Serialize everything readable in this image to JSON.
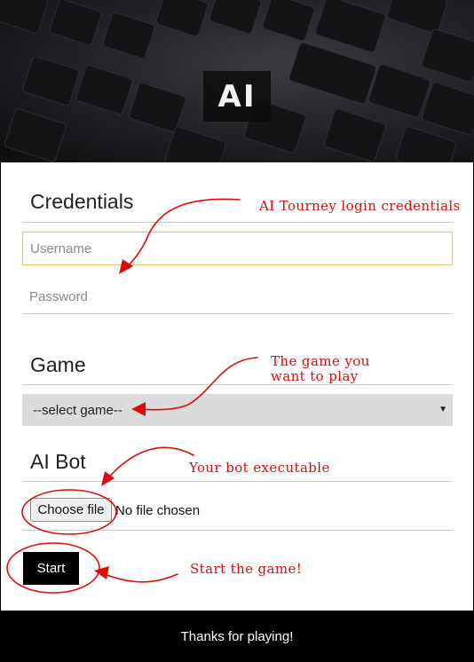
{
  "hero": {
    "logo_text": "AI"
  },
  "sections": {
    "credentials": "Credentials",
    "game": "Game",
    "bot": "AI Bot"
  },
  "form": {
    "username_placeholder": "Username",
    "password_placeholder": "Password",
    "game_select_value": "--select game--",
    "file_button_label": "Choose file",
    "file_status": "No file chosen",
    "start_label": "Start"
  },
  "annotations": {
    "credentials": "AI Tourney login credentials",
    "game_line1": "The game you",
    "game_line2": "want to play",
    "bot": "Your bot executable",
    "start": "Start the game!"
  },
  "footer": {
    "text": "Thanks for playing!"
  },
  "colors": {
    "annotation": "#d80d0d",
    "select_bg": "#dcdcdc",
    "focus_border": "#e0c86a"
  }
}
